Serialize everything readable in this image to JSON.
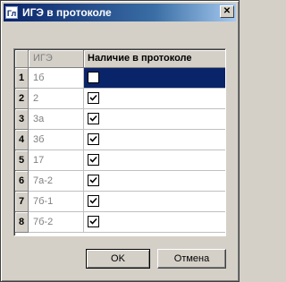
{
  "window": {
    "title": "ИГЭ в протоколе",
    "icon_text": "Гл",
    "close_symbol": "✕"
  },
  "grid": {
    "columns": [
      "ИГЭ",
      "Наличие в протоколе"
    ],
    "rows": [
      {
        "num": "1",
        "ige": "1б",
        "checked": false,
        "selected": true
      },
      {
        "num": "2",
        "ige": "2",
        "checked": true,
        "selected": false
      },
      {
        "num": "3",
        "ige": "3а",
        "checked": true,
        "selected": false
      },
      {
        "num": "4",
        "ige": "3б",
        "checked": true,
        "selected": false
      },
      {
        "num": "5",
        "ige": "17",
        "checked": true,
        "selected": false
      },
      {
        "num": "6",
        "ige": "7а-2",
        "checked": true,
        "selected": false
      },
      {
        "num": "7",
        "ige": "7б-1",
        "checked": true,
        "selected": false
      },
      {
        "num": "8",
        "ige": "7б-2",
        "checked": true,
        "selected": false
      }
    ]
  },
  "buttons": {
    "ok_label": "OK",
    "cancel_label": "Отмена"
  }
}
